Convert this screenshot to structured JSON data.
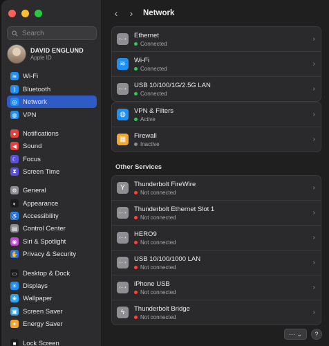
{
  "window": {
    "traffic_colors": [
      "#fe5f57",
      "#febc2e",
      "#28c840"
    ]
  },
  "sidebar": {
    "search_placeholder": "Search",
    "account": {
      "name": "DAVID ENGLUND",
      "sub": "Apple ID"
    },
    "items": [
      {
        "label": "Wi-Fi",
        "icon": "wifi-icon",
        "color": "#1e8ff5",
        "glyph": "≋",
        "active": false
      },
      {
        "label": "Bluetooth",
        "icon": "bluetooth-icon",
        "color": "#1e8ff5",
        "glyph": "ᛒ",
        "active": false
      },
      {
        "label": "Network",
        "icon": "globe-icon",
        "color": "#1e8ff5",
        "glyph": "◎",
        "active": true
      },
      {
        "label": "VPN",
        "icon": "vpn-globe-icon",
        "color": "#1e8ff5",
        "glyph": "◍",
        "active": false
      },
      {
        "label": "Notifications",
        "icon": "bell-icon",
        "color": "#e8413d",
        "glyph": "●",
        "active": false
      },
      {
        "label": "Sound",
        "icon": "speaker-icon",
        "color": "#e8413d",
        "glyph": "◀",
        "active": false
      },
      {
        "label": "Focus",
        "icon": "moon-icon",
        "color": "#5b4fd9",
        "glyph": "☾",
        "active": false
      },
      {
        "label": "Screen Time",
        "icon": "hourglass-icon",
        "color": "#5b4fd9",
        "glyph": "⧗",
        "active": false
      },
      {
        "label": "General",
        "icon": "gear-icon",
        "color": "#8e8e93",
        "glyph": "⚙",
        "active": false
      },
      {
        "label": "Appearance",
        "icon": "appearance-icon",
        "color": "#1c1c1e",
        "glyph": "◐",
        "active": false
      },
      {
        "label": "Accessibility",
        "icon": "accessibility-icon",
        "color": "#1e8ff5",
        "glyph": "♿",
        "active": false
      },
      {
        "label": "Control Center",
        "icon": "control-center-icon",
        "color": "#8e8e93",
        "glyph": "▤",
        "active": false
      },
      {
        "label": "Siri & Spotlight",
        "icon": "siri-icon",
        "color": "#c44bd8",
        "glyph": "◉",
        "active": false
      },
      {
        "label": "Privacy & Security",
        "icon": "hand-icon",
        "color": "#2b6fe0",
        "glyph": "✋",
        "active": false
      },
      {
        "label": "Desktop & Dock",
        "icon": "dock-icon",
        "color": "#1c1c1e",
        "glyph": "▭",
        "active": false
      },
      {
        "label": "Displays",
        "icon": "display-icon",
        "color": "#1e8ff5",
        "glyph": "☀",
        "active": false
      },
      {
        "label": "Wallpaper",
        "icon": "wallpaper-icon",
        "color": "#2aa3f0",
        "glyph": "❀",
        "active": false
      },
      {
        "label": "Screen Saver",
        "icon": "screen-saver-icon",
        "color": "#3aa7e8",
        "glyph": "▣",
        "active": false
      },
      {
        "label": "Energy Saver",
        "icon": "lightbulb-icon",
        "color": "#f2a531",
        "glyph": "✦",
        "active": false
      },
      {
        "label": "Lock Screen",
        "icon": "lock-icon",
        "color": "#1c1c1e",
        "glyph": "■",
        "active": false
      }
    ]
  },
  "header": {
    "back": "‹",
    "forward": "›",
    "title": "Network"
  },
  "groups": [
    {
      "rows": [
        {
          "name": "Ethernet",
          "status": "Connected",
          "status_color": "#34c759",
          "icon": "ethernet-icon",
          "icon_color": "#8e8e93",
          "glyph": "‹···›"
        },
        {
          "name": "Wi-Fi",
          "status": "Connected",
          "status_color": "#34c759",
          "icon": "wifi-icon",
          "icon_color": "#1e8ff5",
          "glyph": "≋"
        },
        {
          "name": "USB 10/100/1G/2.5G LAN",
          "status": "Connected",
          "status_color": "#34c759",
          "icon": "ethernet-icon",
          "icon_color": "#8e8e93",
          "glyph": "‹···›"
        }
      ]
    },
    {
      "rows": [
        {
          "name": "VPN & Filters",
          "status": "Active",
          "status_color": "#34c759",
          "icon": "vpn-globe-icon",
          "icon_color": "#1e8ff5",
          "glyph": "◍"
        },
        {
          "name": "Firewall",
          "status": "Inactive",
          "status_color": "#8e8e93",
          "icon": "firewall-icon",
          "icon_color": "#f2a531",
          "glyph": "▦"
        }
      ]
    }
  ],
  "other_services": {
    "title": "Other Services",
    "rows": [
      {
        "name": "Thunderbolt FireWire",
        "status": "Not connected",
        "status_color": "#ff453a",
        "icon": "firewire-icon",
        "icon_color": "#8e8e93",
        "glyph": "Y"
      },
      {
        "name": "Thunderbolt Ethernet Slot 1",
        "status": "Not connected",
        "status_color": "#ff453a",
        "icon": "ethernet-icon",
        "icon_color": "#8e8e93",
        "glyph": "‹···›"
      },
      {
        "name": "HERO9",
        "status": "Not connected",
        "status_color": "#ff453a",
        "icon": "ethernet-icon",
        "icon_color": "#8e8e93",
        "glyph": "‹···›"
      },
      {
        "name": "USB 10/100/1000 LAN",
        "status": "Not connected",
        "status_color": "#ff453a",
        "icon": "ethernet-icon",
        "icon_color": "#8e8e93",
        "glyph": "‹···›"
      },
      {
        "name": "iPhone USB",
        "status": "Not connected",
        "status_color": "#ff453a",
        "icon": "ethernet-icon",
        "icon_color": "#8e8e93",
        "glyph": "‹···›"
      },
      {
        "name": "Thunderbolt Bridge",
        "status": "Not connected",
        "status_color": "#ff453a",
        "icon": "thunderbolt-icon",
        "icon_color": "#8e8e93",
        "glyph": "ϟ"
      }
    ]
  },
  "footer": {
    "more_label": "··· ⌄",
    "help_label": "?"
  }
}
